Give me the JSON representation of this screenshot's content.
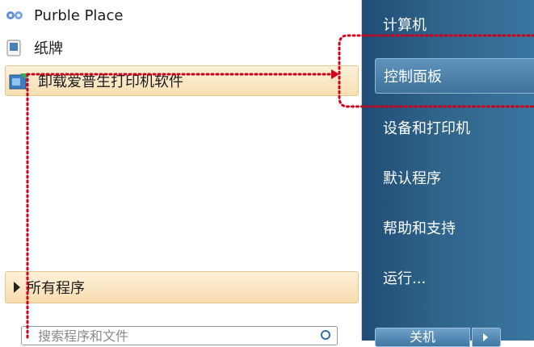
{
  "left_panel": {
    "programs": [
      {
        "label": "Purble Place",
        "icon": "purble-place-icon"
      },
      {
        "label": "纸牌",
        "icon": "solitaire-icon"
      },
      {
        "label": "卸载爱普生打印机软件",
        "icon": "uninstall-icon"
      }
    ],
    "all_programs_label": "所有程序",
    "search_placeholder": "搜索程序和文件"
  },
  "right_panel": {
    "items": [
      "计算机",
      "控制面板",
      "设备和打印机",
      "默认程序",
      "帮助和支持",
      "运行..."
    ],
    "shutdown_label": "关机"
  },
  "colors": {
    "annotation": "#d1001a",
    "highlight": "#f8dfb2",
    "right_panel": "#2e6289"
  }
}
